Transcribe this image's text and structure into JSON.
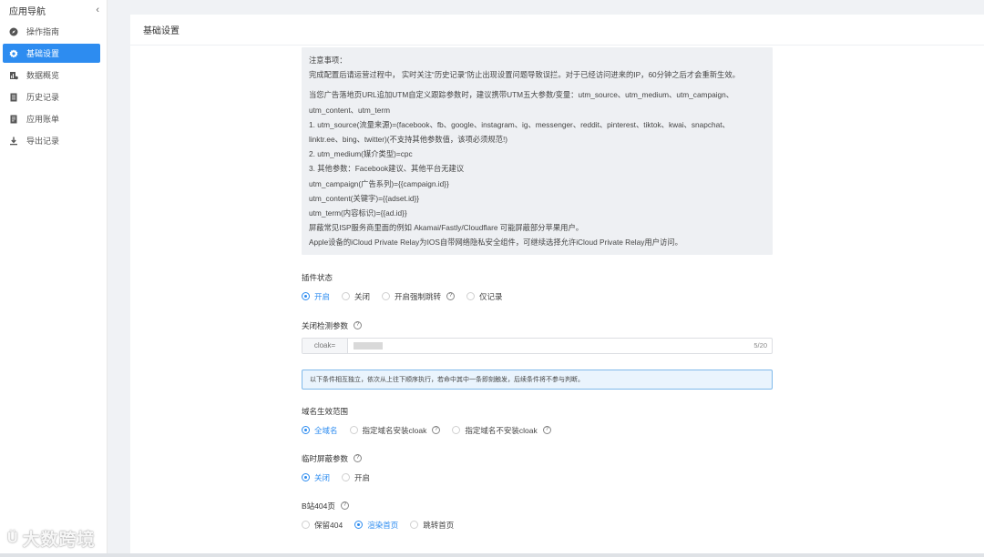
{
  "sidebar": {
    "title": "应用导航",
    "collapse_icon": "chevron-left-icon",
    "items": [
      {
        "label": "操作指南",
        "icon": "compass-icon",
        "active": false
      },
      {
        "label": "基础设置",
        "icon": "gear-icon",
        "active": true
      },
      {
        "label": "数据概览",
        "icon": "chart-icon",
        "active": false
      },
      {
        "label": "历史记录",
        "icon": "document-icon",
        "active": false
      },
      {
        "label": "应用账单",
        "icon": "bill-icon",
        "active": false
      },
      {
        "label": "导出记录",
        "icon": "download-icon",
        "active": false
      }
    ]
  },
  "page": {
    "title": "基础设置"
  },
  "notice": {
    "lines": [
      "注意事项：",
      "完成配置后请运营过程中，  实时关注“历史记录”防止出现设置问题导致误拦。对于已经访问进来的IP，60分钟之后才会重新生效。",
      "当您广告落地页URL追加UTM自定义跟踪参数时，建议携带UTM五大参数/变量：utm_source、utm_medium、utm_campaign、",
      "utm_content、utm_term",
      "1. utm_source(流量来源)=(facebook、fb、google、instagram、ig、messenger、reddit、pinterest、tiktok、kwai、snapchat、",
      "linktr.ee、bing、twitter)(不支持其他参数值，该项必须规范!)",
      "2. utm_medium(媒介类型)=cpc",
      "3. 其他参数：Facebook建议、其他平台无建议",
      "utm_campaign(广告系列)={{campaign.id}}",
      "utm_content(关键字)={{adset.id}}",
      "utm_term(内容标识)={{ad.id}}",
      "屏蔽常见ISP服务商里面的例如 Akamai/Fastly/Cloudflare 可能屏蔽部分苹果用户。",
      "Apple设备的iCloud Private Relay为IOS自带网络隐私安全组件，可继续选择允许iCloud Private Relay用户访问。"
    ]
  },
  "plugin_status": {
    "label": "插件状态",
    "options": [
      {
        "label": "开启",
        "checked": true,
        "help": false
      },
      {
        "label": "关闭",
        "checked": false,
        "help": false
      },
      {
        "label": "开启强制跳转",
        "checked": false,
        "help": true
      },
      {
        "label": "仅记录",
        "checked": false,
        "help": false
      }
    ]
  },
  "close_param": {
    "label": "关闭检测参数",
    "prefix": "cloak=",
    "counter": "5/20"
  },
  "info_message": "以下条件相互独立，依次从上往下顺序执行，若命中其中一条即刻触发，后续条件将不参与判断。",
  "domain_scope": {
    "label": "域名生效范围",
    "options": [
      {
        "label": "全域名",
        "checked": true,
        "help": false
      },
      {
        "label": "指定域名安装cloak",
        "checked": false,
        "help": true
      },
      {
        "label": "指定域名不安装cloak",
        "checked": false,
        "help": true
      }
    ]
  },
  "temp_block": {
    "label": "临时屏蔽参数",
    "options": [
      {
        "label": "关闭",
        "checked": true,
        "help": false
      },
      {
        "label": "开启",
        "checked": false,
        "help": false
      }
    ]
  },
  "b_page": {
    "label": "B站404页",
    "options": [
      {
        "label": "保留404",
        "checked": false,
        "help": false
      },
      {
        "label": "渲染首页",
        "checked": true,
        "help": false
      },
      {
        "label": "跳转首页",
        "checked": false,
        "help": false
      }
    ]
  },
  "watermark": {
    "text": "大数跨境",
    "logo": "Ü"
  },
  "colors": {
    "accent": "#2d8cf0",
    "notice_bg": "#eef0f3",
    "info_border": "#7fb9ea",
    "info_bg": "#eaf4fd"
  }
}
